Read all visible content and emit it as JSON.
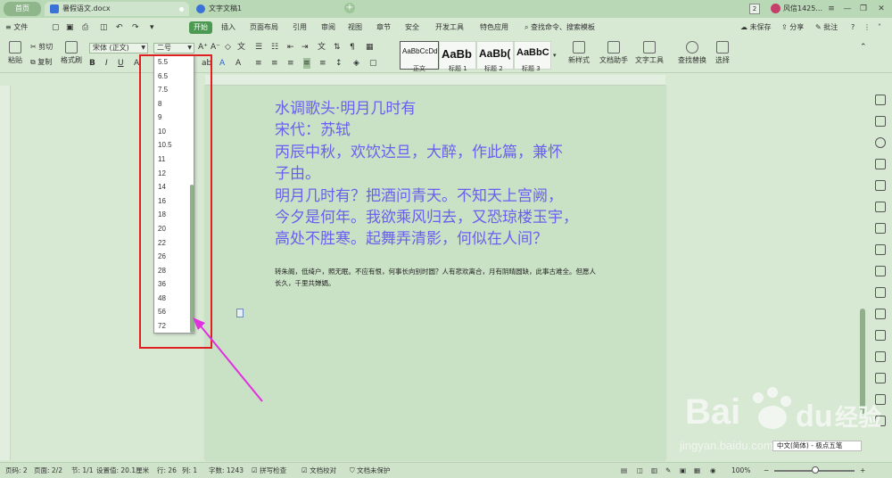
{
  "tabs": {
    "home": "首页",
    "active_doc": "暑假语文.docx",
    "second_doc": "文字文稿1",
    "plus": "+"
  },
  "titlebar_right": {
    "badge": "2",
    "user": "风信1425...",
    "menu_icon": "≡",
    "minimize": "—",
    "restore": "❐",
    "close": "✕"
  },
  "menubar": {
    "file": "≡ 文件",
    "items": [
      "开始",
      "插入",
      "页面布局",
      "引用",
      "审阅",
      "视图",
      "章节",
      "安全",
      "开发工具",
      "特色应用"
    ],
    "search": "查找命令、搜索模板",
    "unsaved": "未保存",
    "share": "分享",
    "comment": "批注"
  },
  "ribbon": {
    "paste": "粘贴",
    "cut": "剪切",
    "copy": "复制",
    "format_painter": "格式刷",
    "font_name": "宋体 (正文)",
    "font_size": "二号",
    "styles": [
      {
        "preview": "AaBbCcDd",
        "name": "正文"
      },
      {
        "preview": "AaBb",
        "name": "标题 1"
      },
      {
        "preview": "AaBb(",
        "name": "标题 2"
      },
      {
        "preview": "AaBbC",
        "name": "标题 3"
      }
    ],
    "new_style": "新样式",
    "doc_assistant": "文档助手",
    "text_tools": "文字工具",
    "find_replace": "查找替换",
    "select": "选择"
  },
  "font_size_dropdown": {
    "options": [
      "5.5",
      "6.5",
      "7.5",
      "8",
      "9",
      "10",
      "10.5",
      "11",
      "12",
      "14",
      "16",
      "18",
      "20",
      "22",
      "26",
      "28",
      "36",
      "48",
      "56",
      "72"
    ]
  },
  "document": {
    "lines": [
      "水调歌头·明月几时有",
      "宋代：苏轼",
      "丙辰中秋，欢饮达旦，大醉，作此篇，兼怀",
      "子由。",
      "明月几时有？把酒问青天。不知天上宫阙，",
      "今夕是何年。我欲乘风归去，又恐琼楼玉宇，",
      "高处不胜寒。起舞弄清影，何似在人间？"
    ],
    "small_text": "转朱阁，低绮户，照无眠。不应有恨，何事长向别时圆？人有悲欢离合，月有阴晴圆缺，此事古难全。但愿人长久，千里共婵娟。"
  },
  "statusbar": {
    "page_num": "页码: 2",
    "pages": "页面: 2/2",
    "section": "节: 1/1",
    "position": "设置值: 20.1厘米",
    "row": "行: 26",
    "col": "列: 1",
    "word_count": "字数: 1243",
    "spell_check": "拼写检查",
    "doc_proof": "文档校对",
    "unprotected": "文档未保护",
    "zoom": "100%"
  },
  "ime": "中文(简体) - 极点五笔",
  "watermark": {
    "brand": "Bai",
    "brand2": "du",
    "brand_cn": "经验",
    "url": "jingyan.baidu.com"
  },
  "colors": {
    "accent": "#4c9a52",
    "doc_text": "#6a5ff0",
    "highlight_box": "#e02020",
    "arrow": "#e030e0"
  }
}
